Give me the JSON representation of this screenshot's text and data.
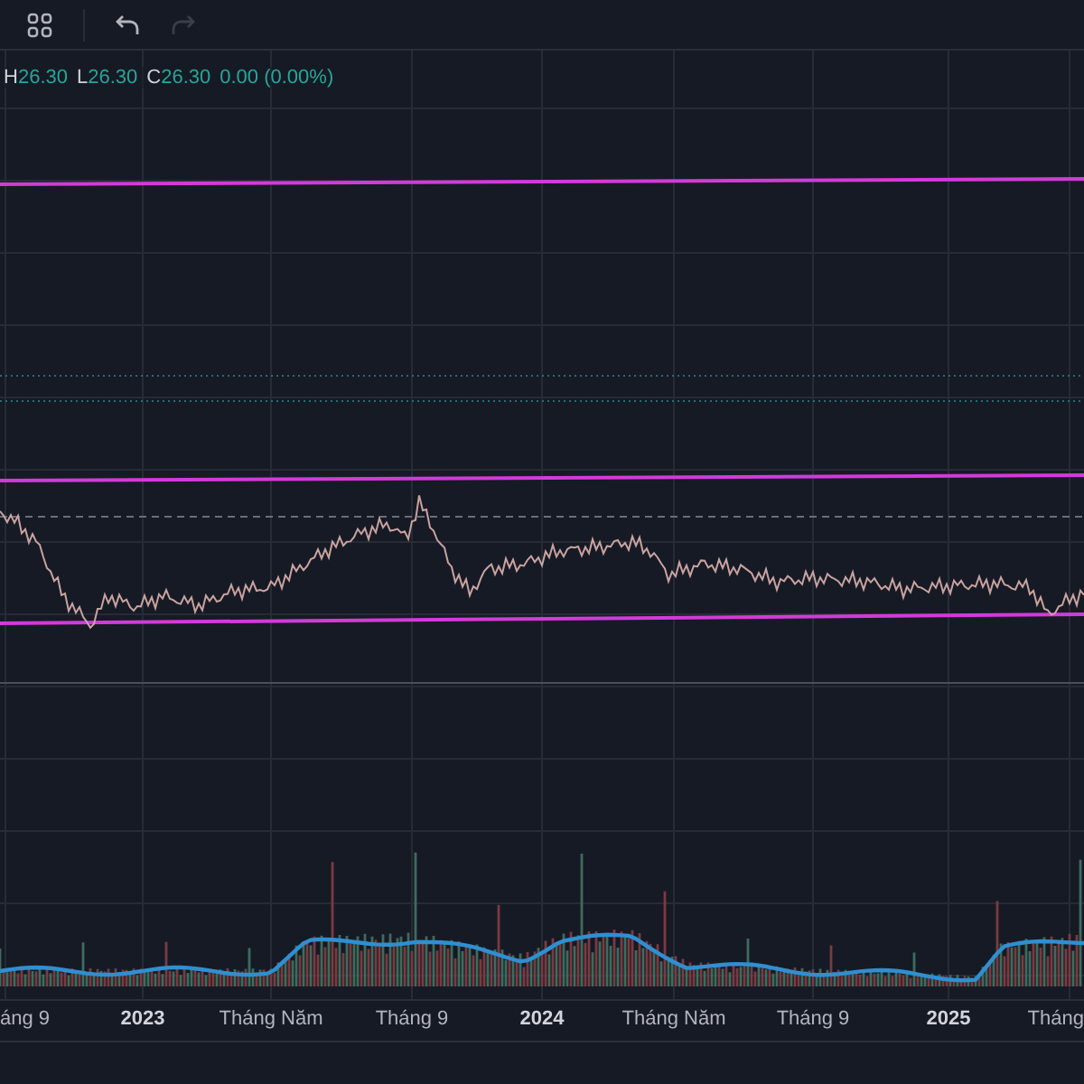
{
  "toolbar": {
    "buttons": [
      {
        "kind": "layout",
        "disabled": false
      },
      {
        "kind": "undo",
        "disabled": false
      },
      {
        "kind": "redo",
        "disabled": true
      }
    ]
  },
  "legend": {
    "items": [
      {
        "label": "H",
        "value": "26.30"
      },
      {
        "label": "L",
        "value": "26.30"
      },
      {
        "label": "C",
        "value": "26.30"
      }
    ],
    "change": "0.00 (0.00%)"
  },
  "time_axis": [
    {
      "label": "áng 9",
      "kind": "month"
    },
    {
      "label": "2023",
      "kind": "year"
    },
    {
      "label": "Tháng Năm",
      "kind": "month"
    },
    {
      "label": "Tháng 9",
      "kind": "month"
    },
    {
      "label": "2024",
      "kind": "year"
    },
    {
      "label": "Tháng Năm",
      "kind": "month"
    },
    {
      "label": "Tháng 9",
      "kind": "month"
    },
    {
      "label": "2025",
      "kind": "year"
    },
    {
      "label": "Tháng",
      "kind": "month"
    }
  ]
}
